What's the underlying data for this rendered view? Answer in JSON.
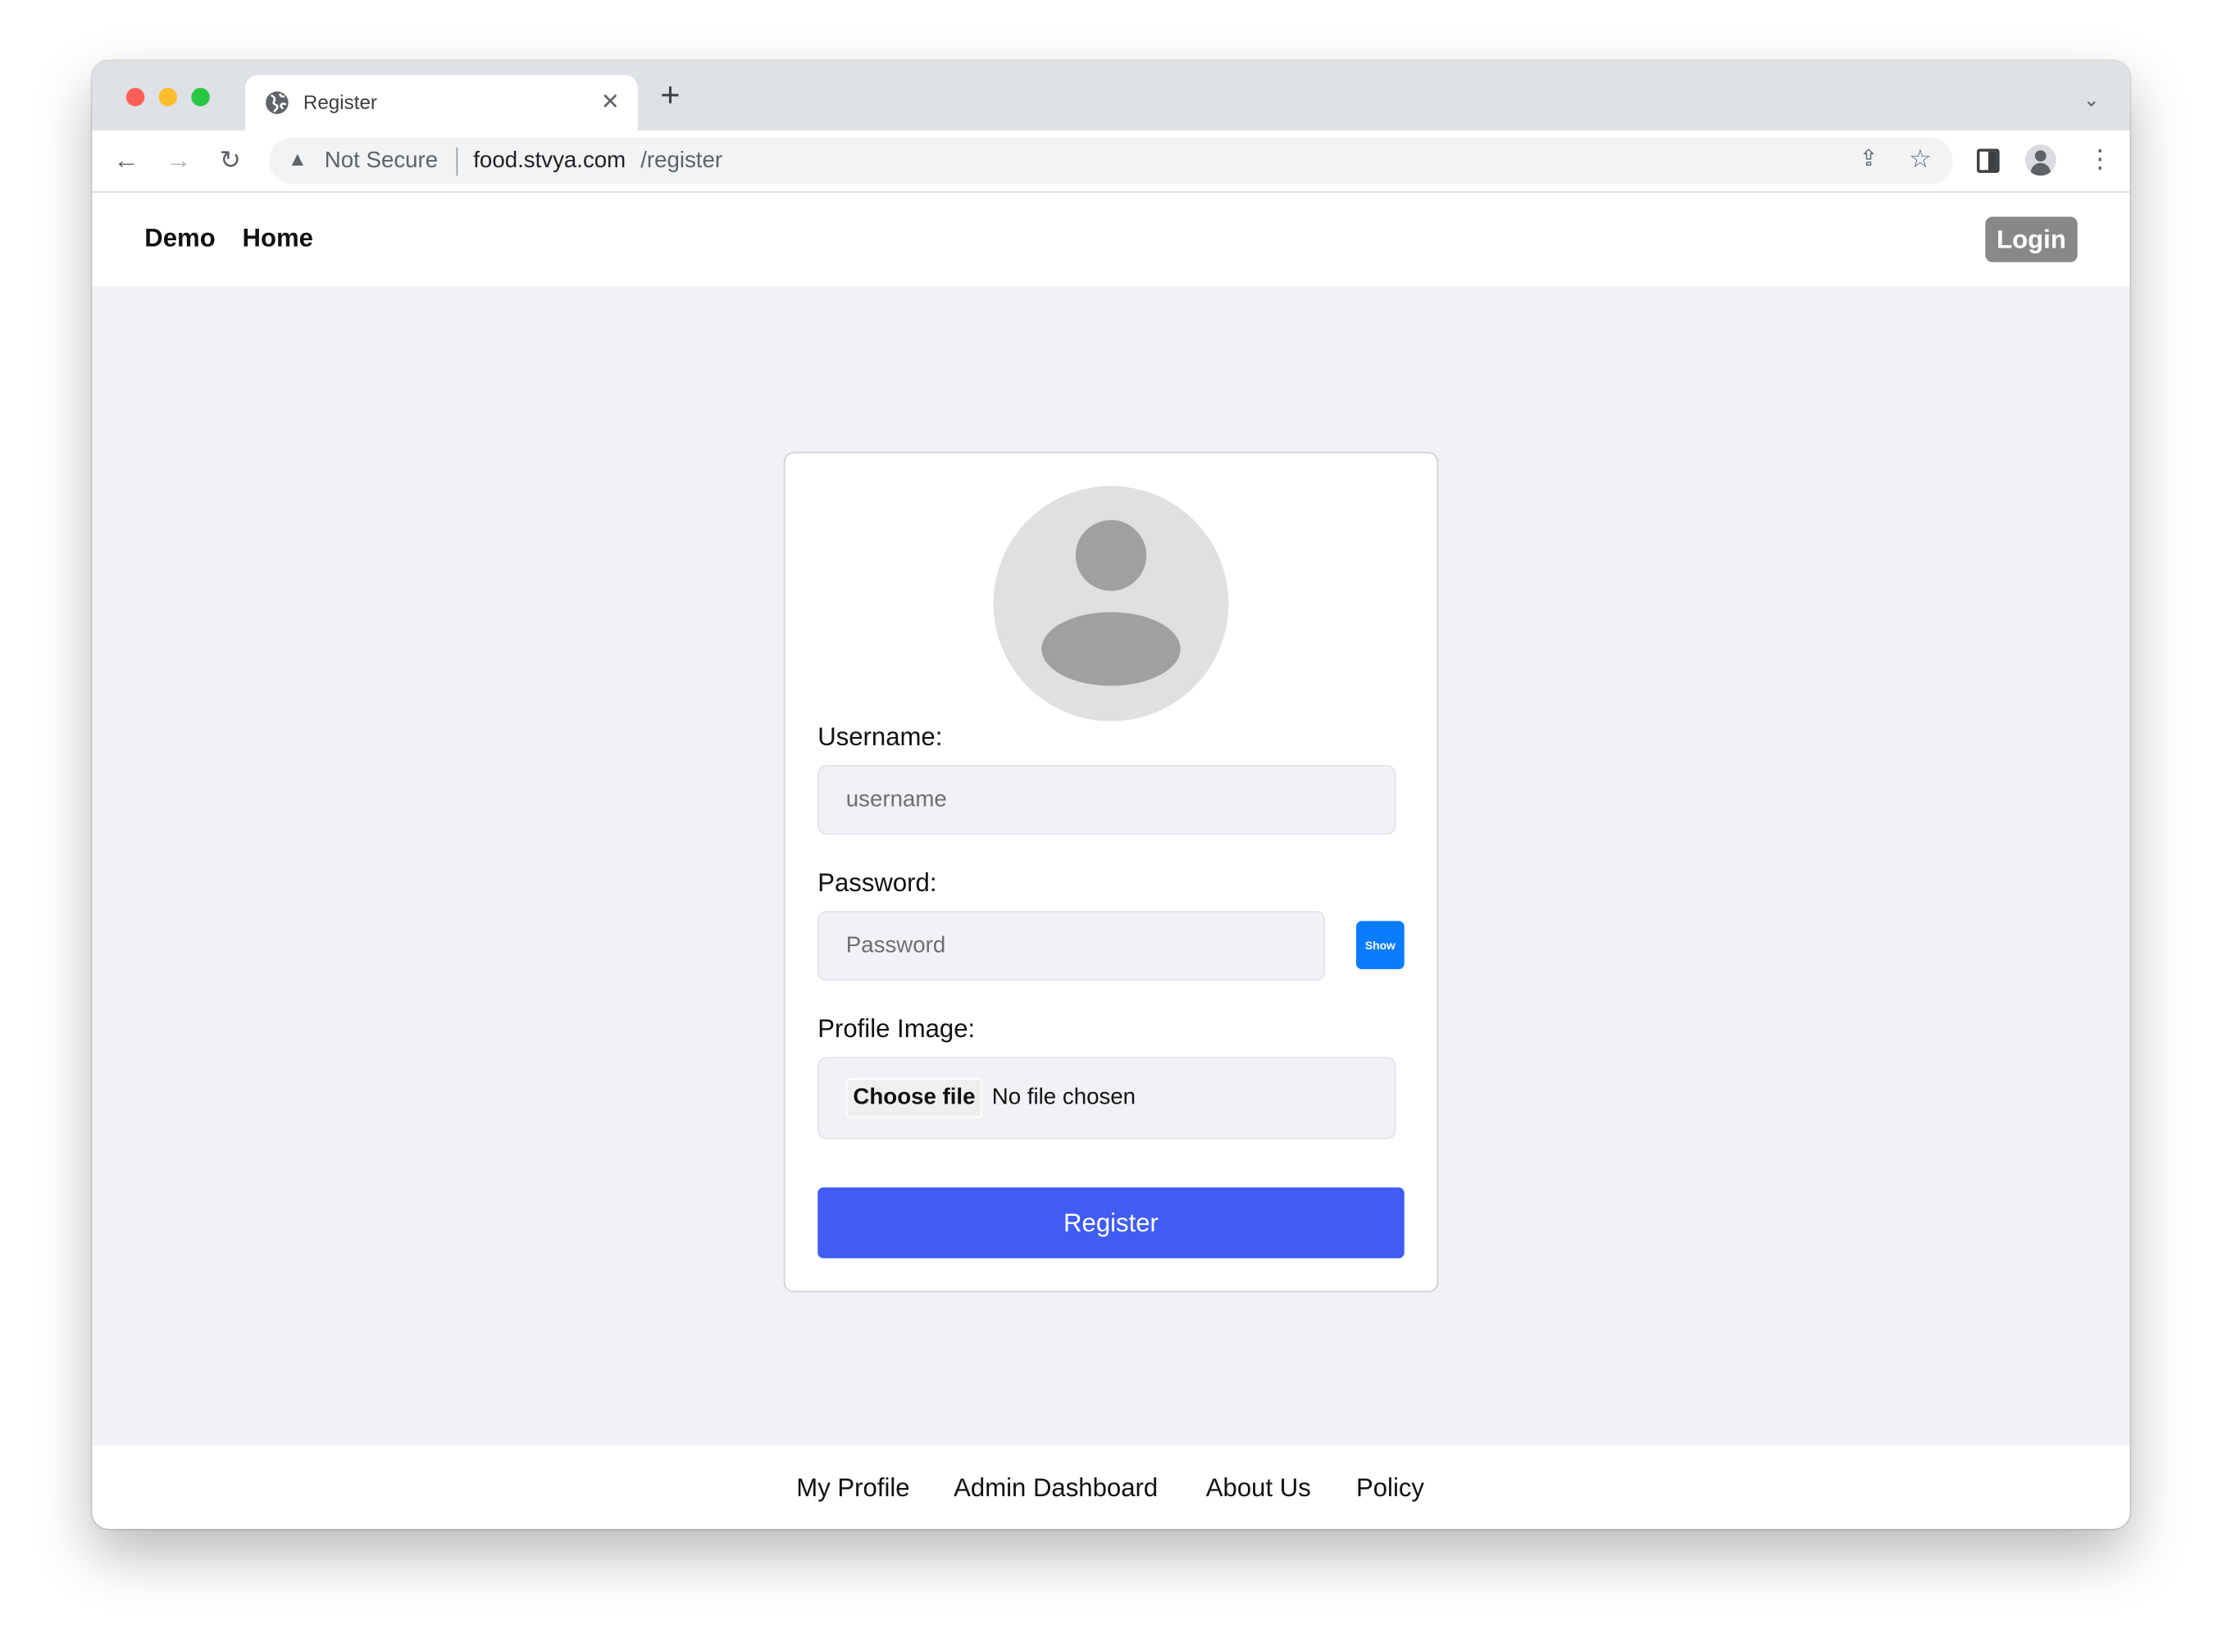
{
  "browser": {
    "tab_title": "Register",
    "url_security": "Not Secure",
    "url_domain": "food.stvya.com",
    "url_path": "/register",
    "icons": [
      "globe-icon",
      "close-icon",
      "plus-icon",
      "chevron-down-icon",
      "back-icon",
      "forward-icon",
      "reload-icon",
      "warning-icon",
      "share-icon",
      "star-icon",
      "sidebar-icon",
      "profile-icon",
      "more-icon"
    ]
  },
  "nav": {
    "brand": "Demo",
    "home": "Home",
    "login": "Login"
  },
  "form": {
    "username_label": "Username:",
    "username_placeholder": "username",
    "password_label": "Password:",
    "password_placeholder": "Password",
    "show_label": "Show",
    "profile_image_label": "Profile Image:",
    "choose_file": "Choose file",
    "no_file": "No file chosen",
    "register": "Register"
  },
  "footer": {
    "links": [
      "My Profile",
      "Admin Dashboard",
      "About Us",
      "Policy"
    ]
  },
  "colors": {
    "register": "#405cf5",
    "show": "#0a7cff",
    "login": "#888888",
    "background": "#f2f2f6"
  }
}
